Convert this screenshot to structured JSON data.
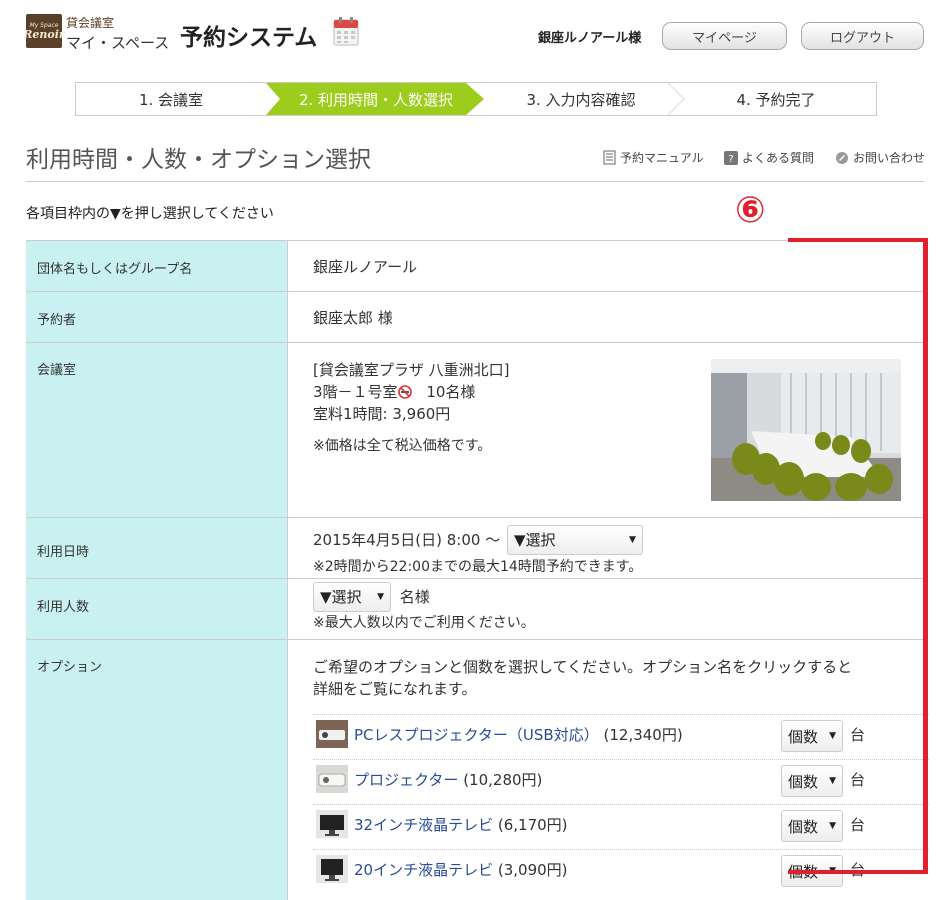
{
  "header": {
    "logo_small": "My Space",
    "logo_brand": "Renoir",
    "logo_top": "貸会議室",
    "logo_bottom": "マイ・スペース",
    "app_title": "予約システム",
    "user_name": "銀座ルノアール様",
    "mypage_label": "マイページ",
    "logout_label": "ログアウト"
  },
  "steps": [
    {
      "label": "1. 会議室",
      "active": false
    },
    {
      "label": "2. 利用時間・人数選択",
      "active": true
    },
    {
      "label": "3. 入力内容確認",
      "active": false
    },
    {
      "label": "4. 予約完了",
      "active": false
    }
  ],
  "page": {
    "title": "利用時間・人数・オプション選択",
    "links": {
      "manual": "予約マニュアル",
      "faq": "よくある質問",
      "contact": "お問い合わせ"
    },
    "instruction": "各項目枠内の▼を押し選択してください"
  },
  "form": {
    "group": {
      "label": "団体名もしくはグループ名",
      "value": "銀座ルノアール"
    },
    "booker": {
      "label": "予約者",
      "value": "銀座太郎 様"
    },
    "room": {
      "label": "会議室",
      "line1": "[貸会議室プラザ 八重洲北口]",
      "line2": "3階－１号室",
      "capacity": "10名様",
      "line3": "室料1時間: 3,960円",
      "note": "※価格は全て税込価格です。"
    },
    "datetime": {
      "label": "利用日時",
      "start": "2015年4月5日(日) 8:00 ～",
      "select": "▼選択",
      "note": "※2時間から22:00までの最大14時間予約できます。"
    },
    "people": {
      "label": "利用人数",
      "select": "▼選択",
      "unit": "名様",
      "note": "※最大人数以内でご利用ください。"
    },
    "options": {
      "label": "オプション",
      "intro1": "ご希望のオプションと個数を選択してください。オプション名をクリックすると",
      "intro2": "詳細をご覧になれます。",
      "items": [
        {
          "name": "PCレスプロジェクター（USB対応）",
          "price": "(12,340円)",
          "select": "個数",
          "unit": "台"
        },
        {
          "name": "プロジェクター",
          "price": "(10,280円)",
          "select": "個数",
          "unit": "台"
        },
        {
          "name": "32インチ液晶テレビ",
          "price": "(6,170円)",
          "select": "個数",
          "unit": "台"
        },
        {
          "name": "20インチ液晶テレビ",
          "price": "(3,090円)",
          "select": "個数",
          "unit": "台"
        }
      ]
    }
  },
  "annotation": {
    "number": "⑥",
    "color": "#e0202e"
  },
  "colors": {
    "accent": "#9ccc1c",
    "label_bg": "#c9f1f1",
    "link": "#2a4c94"
  }
}
